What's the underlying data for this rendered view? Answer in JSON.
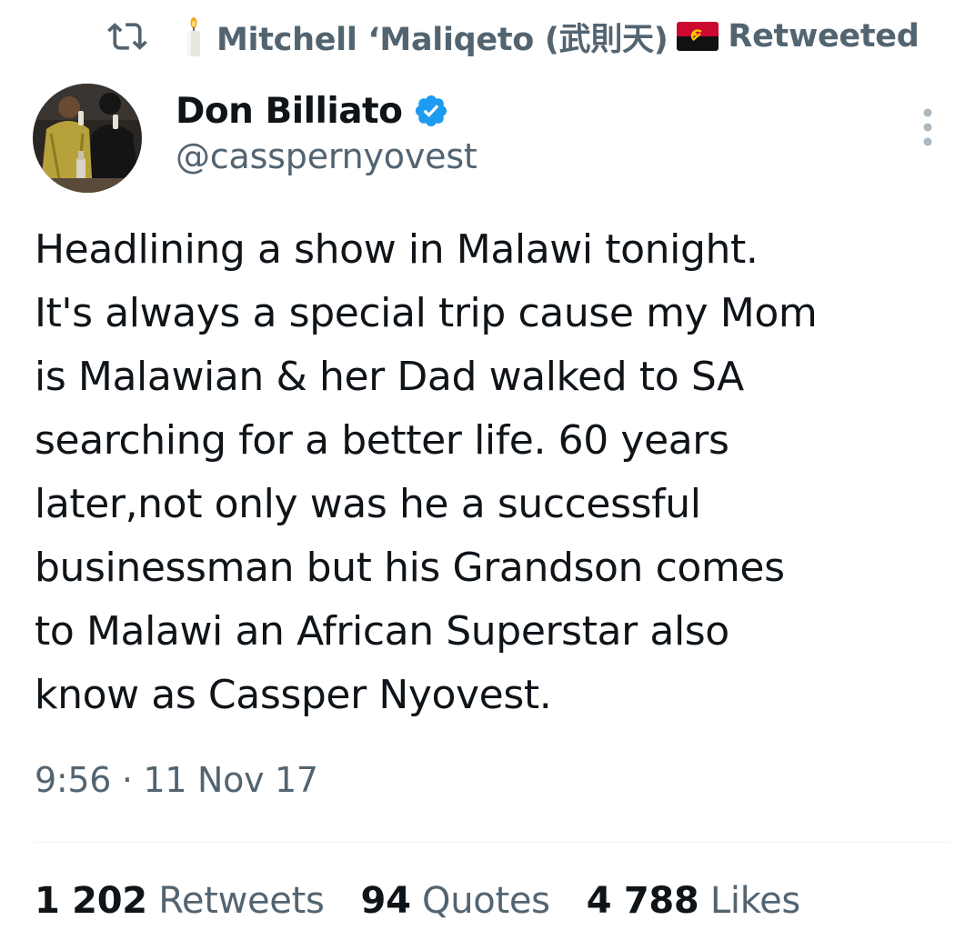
{
  "retweet": {
    "icon": "retweet-icon",
    "emoji_left": "candle-icon",
    "name": "Mitchell ‘Maliqeto (武則天)",
    "emoji_right": "angola-flag-icon",
    "label": "Retweeted"
  },
  "author": {
    "display_name": "Don Billiato",
    "verified": true,
    "handle": "@casspernyovest",
    "avatar": "avatar"
  },
  "tweet": {
    "lines": [
      "Headlining a show in Malawi tonight.",
      "It's always a special trip cause my Mom",
      "is Malawian & her Dad walked to SA",
      "searching for a better life. 60 years",
      "later,not only was he a successful",
      "businessman but his Grandson comes",
      "to Malawi an African Superstar also",
      "know as Cassper Nyovest."
    ],
    "timestamp": "9:56 · 11 Nov 17"
  },
  "stats": [
    {
      "count": "1 202",
      "label": "Retweets"
    },
    {
      "count": "94",
      "label": "Quotes"
    },
    {
      "count": "4 788",
      "label": "Likes"
    }
  ],
  "colors": {
    "text": "#0f1419",
    "secondary": "#536471",
    "verified": "#1d9bf0",
    "divider": "#eff3f4"
  }
}
